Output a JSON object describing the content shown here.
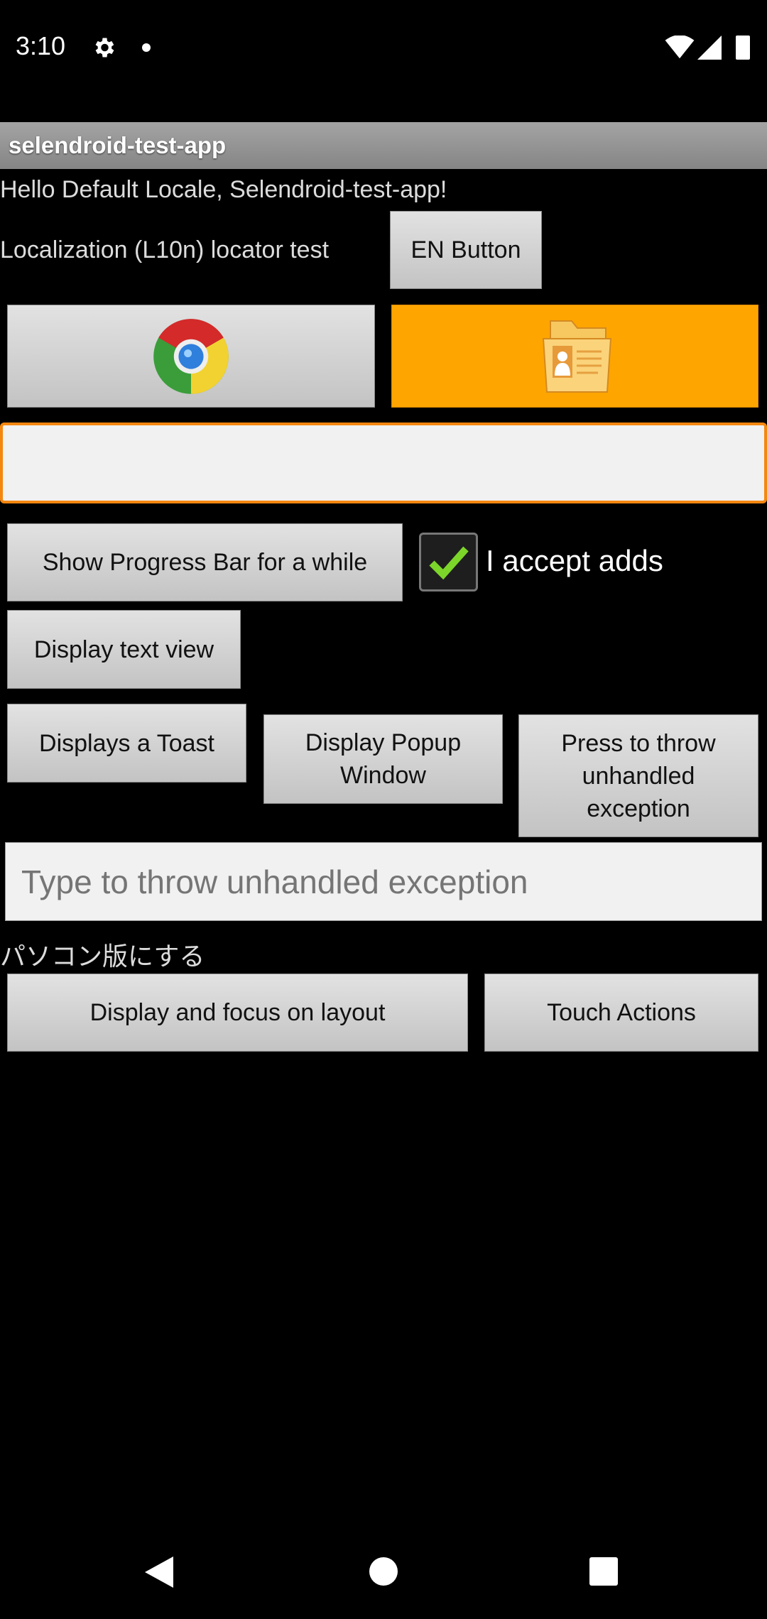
{
  "status_bar": {
    "time": "3:10",
    "icons": [
      "gear-icon",
      "dot-icon",
      "wifi-icon",
      "signal-icon",
      "battery-icon"
    ]
  },
  "app": {
    "title": "selendroid-test-app"
  },
  "main": {
    "hello_text": "Hello Default Locale, Selendroid-test-app!",
    "l10n_label": "Localization (L10n) locator test",
    "en_button": "EN Button",
    "chrome_button_icon": "chrome-icon",
    "contacts_button_icon": "contact-folder-icon",
    "top_input_value": "",
    "progress_button": "Show Progress Bar for a while",
    "checkbox": {
      "label": "I accept adds",
      "checked": true
    },
    "text_view_button": "Display text view",
    "toast_button": "Displays a Toast",
    "popup_button": "Display Popup Window",
    "exception_button": "Press to throw unhandled exception",
    "exception_input_placeholder": "Type to throw unhandled exception",
    "japanese_text": "パソコン版にする",
    "focus_layout_button": "Display and focus on layout",
    "touch_actions_button": "Touch Actions"
  },
  "colors": {
    "accent": "#FFA500",
    "checkmark": "#7CD62A"
  }
}
